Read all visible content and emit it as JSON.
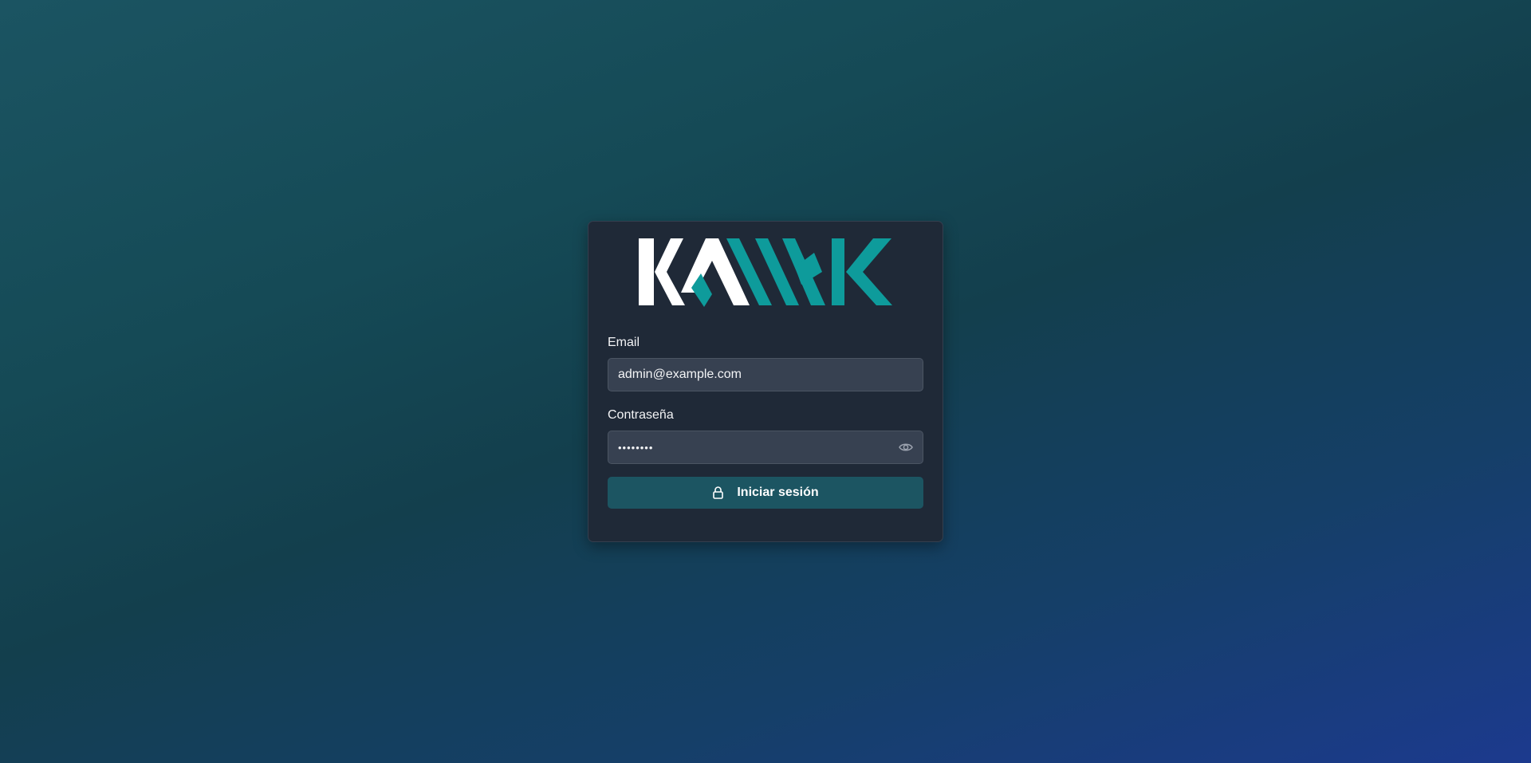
{
  "brand": {
    "logo_text": "KAMAK",
    "logo_colors": {
      "primary": "#ffffff",
      "accent": "#0e9b9b"
    }
  },
  "form": {
    "email": {
      "label": "Email",
      "value": "admin@example.com"
    },
    "password": {
      "label": "Contraseña",
      "masked_value": "••••••••",
      "toggle_icon": "eye-icon"
    },
    "submit": {
      "label": "Iniciar sesión",
      "icon": "lock-icon"
    }
  },
  "colors": {
    "card_bg": "#1f2937",
    "input_bg": "#374151",
    "button_bg": "#1c5562"
  }
}
